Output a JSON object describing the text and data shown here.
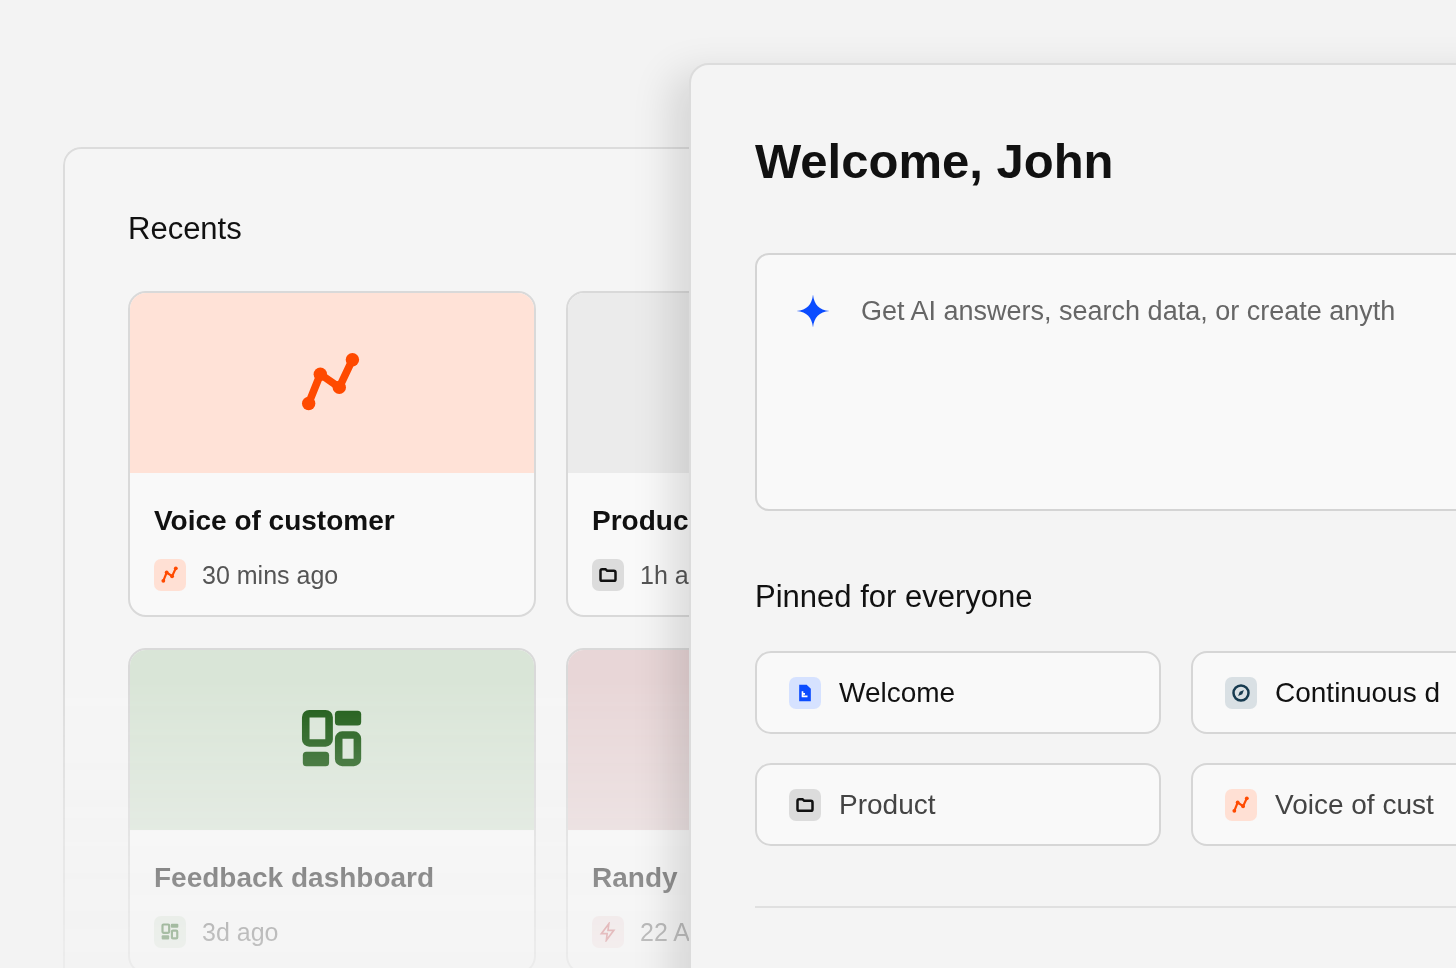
{
  "recents": {
    "title": "Recents",
    "cards": [
      {
        "title": "Voice of customer",
        "time": "30 mins ago",
        "kind": "chart"
      },
      {
        "title": "Produc",
        "time": "1h a",
        "kind": "folder"
      },
      {
        "title": "Feedback dashboard",
        "time": "3d ago",
        "kind": "dashboard"
      },
      {
        "title": "Randy",
        "time": "22 A",
        "kind": "bolt"
      }
    ]
  },
  "home": {
    "title": "Welcome, John",
    "search": {
      "placeholder": "Get AI answers, search data, or create anyth"
    },
    "pinned": {
      "title": "Pinned for everyone",
      "items": [
        {
          "label": "Welcome",
          "kind": "doc"
        },
        {
          "label": "Continuous d",
          "kind": "compass"
        },
        {
          "label": "Product",
          "kind": "folder"
        },
        {
          "label": "Voice of cust",
          "kind": "chart"
        }
      ]
    }
  }
}
